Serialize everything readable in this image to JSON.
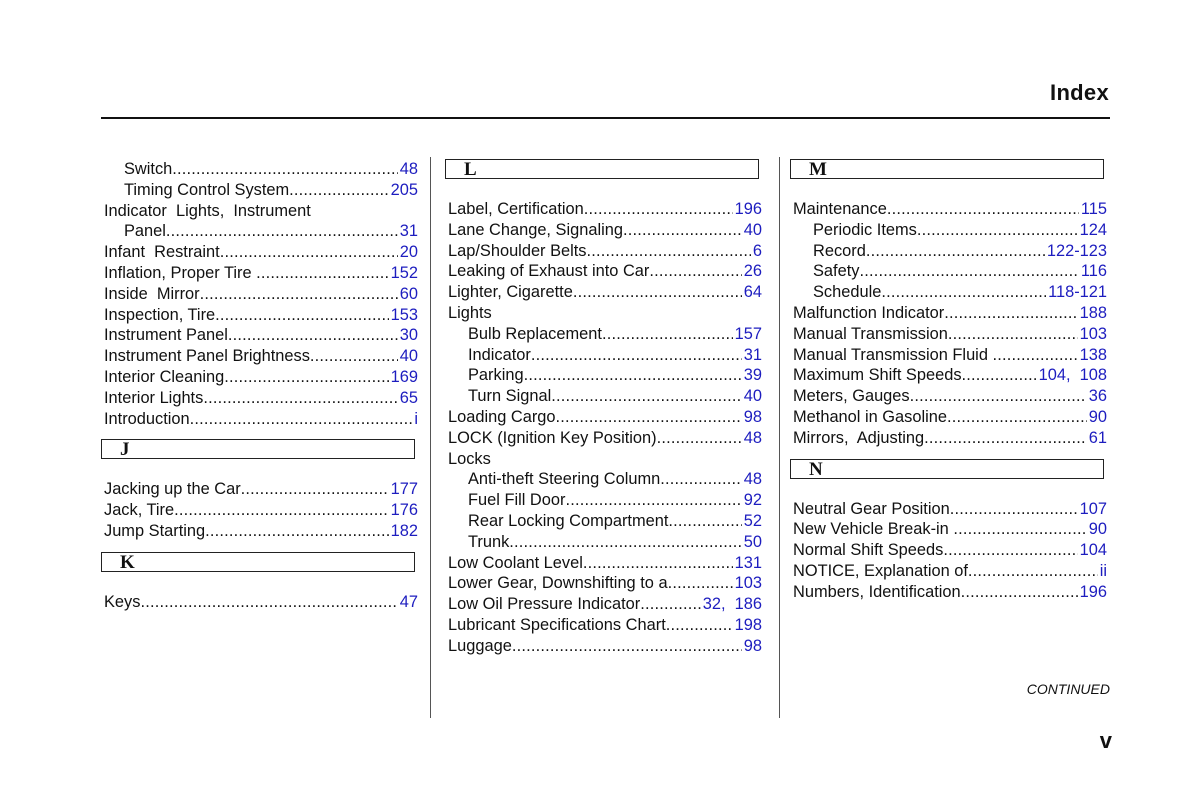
{
  "header": {
    "title": "Index"
  },
  "columns": [
    {
      "blocks": [
        {
          "type": "entries",
          "entries": [
            {
              "term": "Switch",
              "pages": "48",
              "level": 1
            },
            {
              "term": "Timing Control System",
              "pages": "205",
              "level": 1
            },
            {
              "term": "Indicator  Lights,  Instrument",
              "pages": "",
              "level": 0
            },
            {
              "term": "Panel",
              "pages": "31",
              "level": 1
            },
            {
              "term": "Infant  Restraint",
              "pages": "20",
              "level": 0
            },
            {
              "term": "Inflation, Proper Tire ",
              "pages": "152",
              "level": 0
            },
            {
              "term": "Inside  Mirror",
              "pages": "60",
              "level": 0
            },
            {
              "term": "Inspection, Tire",
              "pages": "153",
              "level": 0
            },
            {
              "term": "Instrument Panel",
              "pages": "30",
              "level": 0
            },
            {
              "term": "Instrument Panel Brightness",
              "pages": "40",
              "level": 0
            },
            {
              "term": "Interior Cleaning",
              "pages": "169",
              "level": 0
            },
            {
              "term": "Interior Lights",
              "pages": "65",
              "level": 0
            },
            {
              "term": "Introduction",
              "pages": "i",
              "level": 0
            }
          ]
        },
        {
          "type": "letter",
          "letter": "J"
        },
        {
          "type": "entries",
          "entries": [
            {
              "term": "Jacking up the Car",
              "pages": "177",
              "level": 0
            },
            {
              "term": "Jack, Tire",
              "pages": "176",
              "level": 0
            },
            {
              "term": "Jump Starting",
              "pages": "182",
              "level": 0
            }
          ]
        },
        {
          "type": "letter",
          "letter": "K"
        },
        {
          "type": "entries",
          "entries": [
            {
              "term": "Keys",
              "pages": "47",
              "level": 0
            }
          ]
        }
      ]
    },
    {
      "blocks": [
        {
          "type": "letter",
          "letter": "L"
        },
        {
          "type": "entries",
          "entries": [
            {
              "term": "Label, Certification",
              "pages": "196",
              "level": 0
            },
            {
              "term": "Lane Change, Signaling",
              "pages": "40",
              "level": 0
            },
            {
              "term": "Lap/Shoulder Belts",
              "pages": "6",
              "level": 0
            },
            {
              "term": "Leaking of Exhaust into Car",
              "pages": "26",
              "level": 0
            },
            {
              "term": "Lighter, Cigarette",
              "pages": "64",
              "level": 0
            },
            {
              "term": "Lights",
              "pages": "",
              "level": 0
            },
            {
              "term": "Bulb Replacement",
              "pages": "157",
              "level": 1
            },
            {
              "term": "Indicator",
              "pages": "31",
              "level": 1
            },
            {
              "term": "Parking",
              "pages": "39",
              "level": 1
            },
            {
              "term": "Turn Signal",
              "pages": "40",
              "level": 1
            },
            {
              "term": "Loading Cargo",
              "pages": "98",
              "level": 0
            },
            {
              "term": "LOCK (Ignition Key Position)",
              "pages": "48",
              "level": 0
            },
            {
              "term": "Locks",
              "pages": "",
              "level": 0
            },
            {
              "term": "Anti-theft Steering Column",
              "pages": "48",
              "level": 1
            },
            {
              "term": "Fuel Fill Door",
              "pages": "92",
              "level": 1
            },
            {
              "term": "Rear Locking Compartment",
              "pages": "52",
              "level": 1
            },
            {
              "term": "Trunk",
              "pages": "50",
              "level": 1
            },
            {
              "term": "Low Coolant Level",
              "pages": "131",
              "level": 0
            },
            {
              "term": "Lower Gear, Downshifting to a",
              "pages": "103",
              "level": 0
            },
            {
              "term": "Low Oil Pressure Indicator",
              "pages": "32,  186",
              "level": 0
            },
            {
              "term": "Lubricant Specifications Chart",
              "pages": "198",
              "level": 0
            },
            {
              "term": "Luggage",
              "pages": "98",
              "level": 0
            }
          ]
        }
      ]
    },
    {
      "blocks": [
        {
          "type": "letter",
          "letter": "M"
        },
        {
          "type": "entries",
          "entries": [
            {
              "term": "Maintenance",
              "pages": "115",
              "level": 0
            },
            {
              "term": "Periodic Items",
              "pages": "124",
              "level": 1
            },
            {
              "term": "Record",
              "pages": "122-123",
              "level": 1
            },
            {
              "term": "Safety",
              "pages": "116",
              "level": 1
            },
            {
              "term": "Schedule",
              "pages": "118-121",
              "level": 1
            },
            {
              "term": "Malfunction Indicator",
              "pages": "188",
              "level": 0
            },
            {
              "term": "Manual Transmission",
              "pages": "103",
              "level": 0
            },
            {
              "term": "Manual Transmission Fluid ",
              "pages": "138",
              "level": 0
            },
            {
              "term": "Maximum Shift Speeds",
              "pages": "104,  108",
              "level": 0
            },
            {
              "term": "Meters, Gauges",
              "pages": "36",
              "level": 0
            },
            {
              "term": "Methanol in Gasoline",
              "pages": "90",
              "level": 0
            },
            {
              "term": "Mirrors,  Adjusting",
              "pages": "61",
              "level": 0
            }
          ]
        },
        {
          "type": "letter",
          "letter": "N"
        },
        {
          "type": "entries",
          "entries": [
            {
              "term": "Neutral Gear Position",
              "pages": "107",
              "level": 0
            },
            {
              "term": "New Vehicle Break-in ",
              "pages": "90",
              "level": 0
            },
            {
              "term": "Normal Shift Speeds",
              "pages": "104",
              "level": 0
            },
            {
              "term": "NOTICE, Explanation of",
              "pages": "ii",
              "level": 0
            },
            {
              "term": "Numbers, Identification",
              "pages": "196",
              "level": 0
            }
          ]
        }
      ]
    }
  ],
  "footer": {
    "continued": "CONTINUED",
    "page_number": "v"
  },
  "colors": {
    "page_link": "#1d1dbf",
    "text": "#111111"
  }
}
